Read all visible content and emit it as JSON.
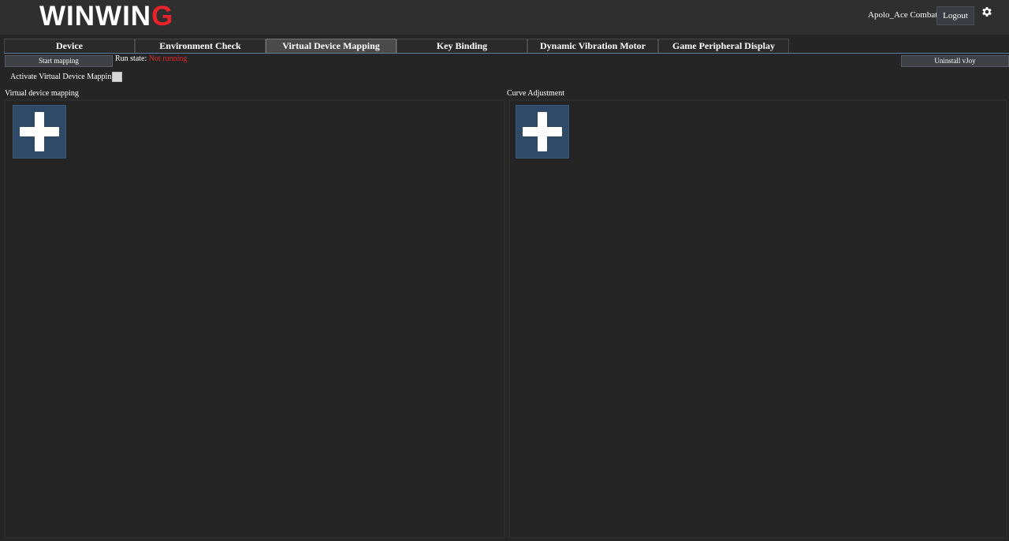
{
  "header": {
    "logo_main": "WINWIN",
    "logo_accent": "G",
    "user_name": "Apolo_Ace Combat",
    "logout_label": "Logout"
  },
  "tabs": [
    {
      "label": "Device",
      "active": false
    },
    {
      "label": "Environment Check",
      "active": false
    },
    {
      "label": "Virtual Device Mapping",
      "active": true
    },
    {
      "label": "Key Binding",
      "active": false
    },
    {
      "label": "Dynamic Vibration Motor",
      "active": false
    },
    {
      "label": "Game Peripheral Display",
      "active": false
    }
  ],
  "toolbar": {
    "start_mapping_label": "Start mapping",
    "run_state_label": "Run state:",
    "run_state_value": "Not running",
    "uninstall_label": "Uninstall vJoy"
  },
  "activate": {
    "label": "Activate Virtual Device Mapping",
    "checked": false
  },
  "sections": {
    "mapping_title": "Virtual device mapping",
    "curve_title": "Curve Adjustment"
  },
  "colors": {
    "accent_red": "#e8232b",
    "add_button_blue": "#2e4a66",
    "background": "#252525"
  }
}
